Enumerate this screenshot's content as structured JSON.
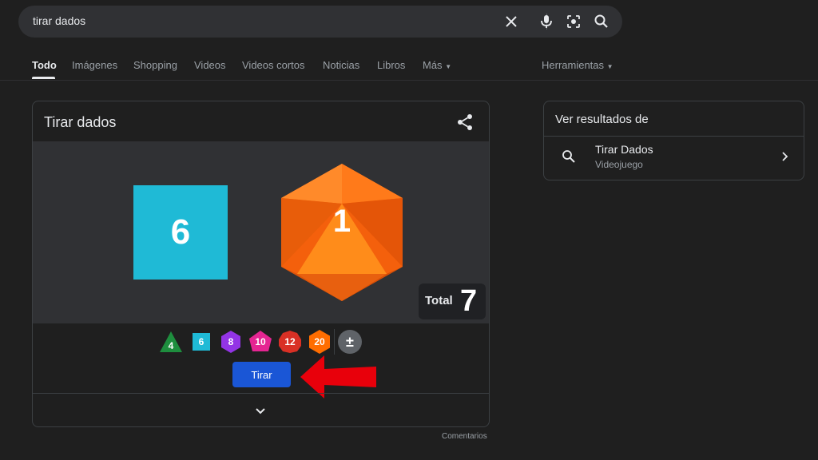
{
  "search": {
    "query": "tirar dados"
  },
  "tabs": [
    {
      "label": "Todo",
      "active": true
    },
    {
      "label": "Imágenes"
    },
    {
      "label": "Shopping"
    },
    {
      "label": "Videos"
    },
    {
      "label": "Videos cortos"
    },
    {
      "label": "Noticias"
    },
    {
      "label": "Libros"
    },
    {
      "label": "Más"
    }
  ],
  "tools_label": "Herramientas",
  "widget": {
    "title": "Tirar dados",
    "dice_results": [
      {
        "die": "d6",
        "value": "6",
        "color": "#1fbad6"
      },
      {
        "die": "d20",
        "value": "1",
        "color": "#ff6d00"
      }
    ],
    "total_label": "Total",
    "total_value": "7",
    "dice_options": [
      {
        "label": "4",
        "color": "#1e8e3e",
        "shape": "triangle"
      },
      {
        "label": "6",
        "color": "#1fbad6",
        "shape": "square"
      },
      {
        "label": "8",
        "color": "#9334e6",
        "shape": "hexagon"
      },
      {
        "label": "10",
        "color": "#e52592",
        "shape": "diamond"
      },
      {
        "label": "12",
        "color": "#d93025",
        "shape": "circle"
      },
      {
        "label": "20",
        "color": "#ff6d00",
        "shape": "hexagon"
      },
      {
        "label": "±",
        "color": "#5f6368",
        "shape": "circle"
      }
    ],
    "roll_label": "Tirar",
    "arrow_color": "#e8000b"
  },
  "comments_label": "Comentarios",
  "side_panel": {
    "title": "Ver resultados de",
    "item_title": "Tirar Dados",
    "item_subtitle": "Videojuego"
  }
}
